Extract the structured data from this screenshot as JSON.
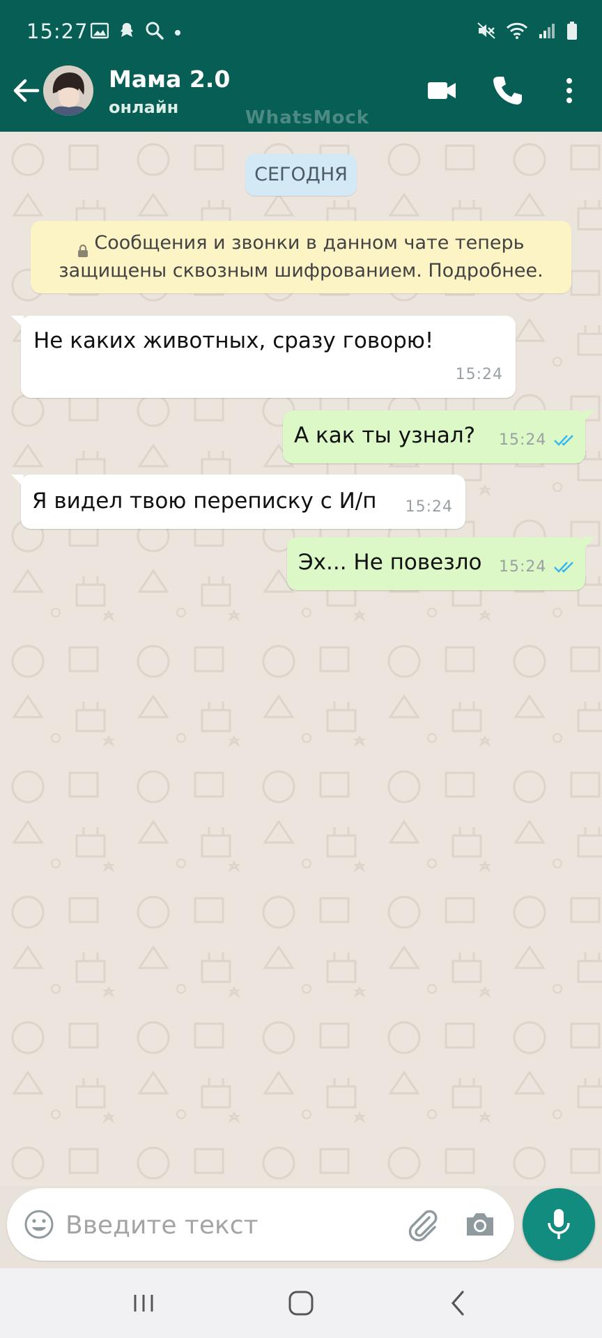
{
  "status_bar": {
    "time": "15:27"
  },
  "header": {
    "contact_name": "Мама 2.0",
    "contact_status": "онлайн",
    "watermark": "WhatsMock"
  },
  "chat": {
    "date_label": "СЕГОДНЯ",
    "system_message_line1": "Сообщения и звонки в данном чате теперь",
    "system_message_line2": "защищены сквозным шифрованием. Подробнее.",
    "messages": [
      {
        "direction": "in",
        "text": "Не каких животных, сразу говорю!",
        "time": "15:24"
      },
      {
        "direction": "out",
        "text": "А как ты узнал?",
        "time": "15:24",
        "read": true
      },
      {
        "direction": "in",
        "text": "Я видел твою переписку с И/п",
        "time": "15:24"
      },
      {
        "direction": "out",
        "text": "Эх... Не повезло",
        "time": "15:24",
        "read": true
      }
    ]
  },
  "composer": {
    "placeholder": "Введите текст"
  },
  "colors": {
    "header": "#075e54",
    "outgoing_bubble": "#dcf8c6",
    "incoming_bubble": "#ffffff",
    "read_ticks": "#34b7f1",
    "mic_button": "#128c7e"
  }
}
